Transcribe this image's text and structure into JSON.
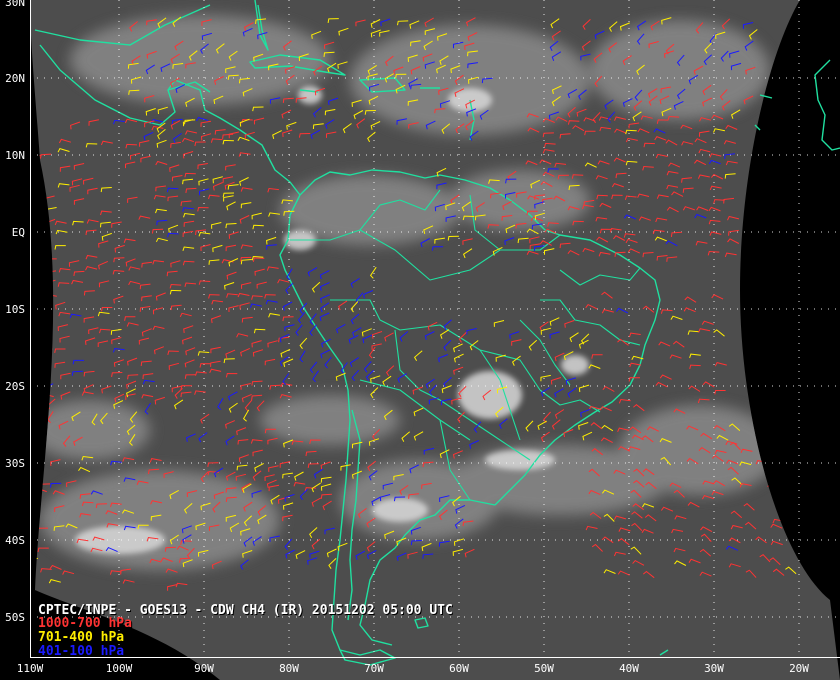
{
  "caption": "CPTEC/INPE - GOES13 - CDW CH4 (IR) 20151202 05:00 UTC",
  "legend": [
    {
      "label": "1000-700 hPa",
      "color": "#ff3333"
    },
    {
      "label": "701-400 hPa",
      "color": "#ffee00"
    },
    {
      "label": "401-100 hPa",
      "color": "#1a1aff"
    }
  ],
  "lat_labels": [
    "30N",
    "20N",
    "10N",
    "EQ",
    "10S",
    "20S",
    "30S",
    "40S",
    "50S"
  ],
  "lon_labels": [
    "110W",
    "100W",
    "90W",
    "80W",
    "70W",
    "60W",
    "50W",
    "40W",
    "30W",
    "20W"
  ],
  "colors": {
    "coastline": "#20e0a0",
    "gridline": "#ffffff",
    "background": "#000000"
  }
}
